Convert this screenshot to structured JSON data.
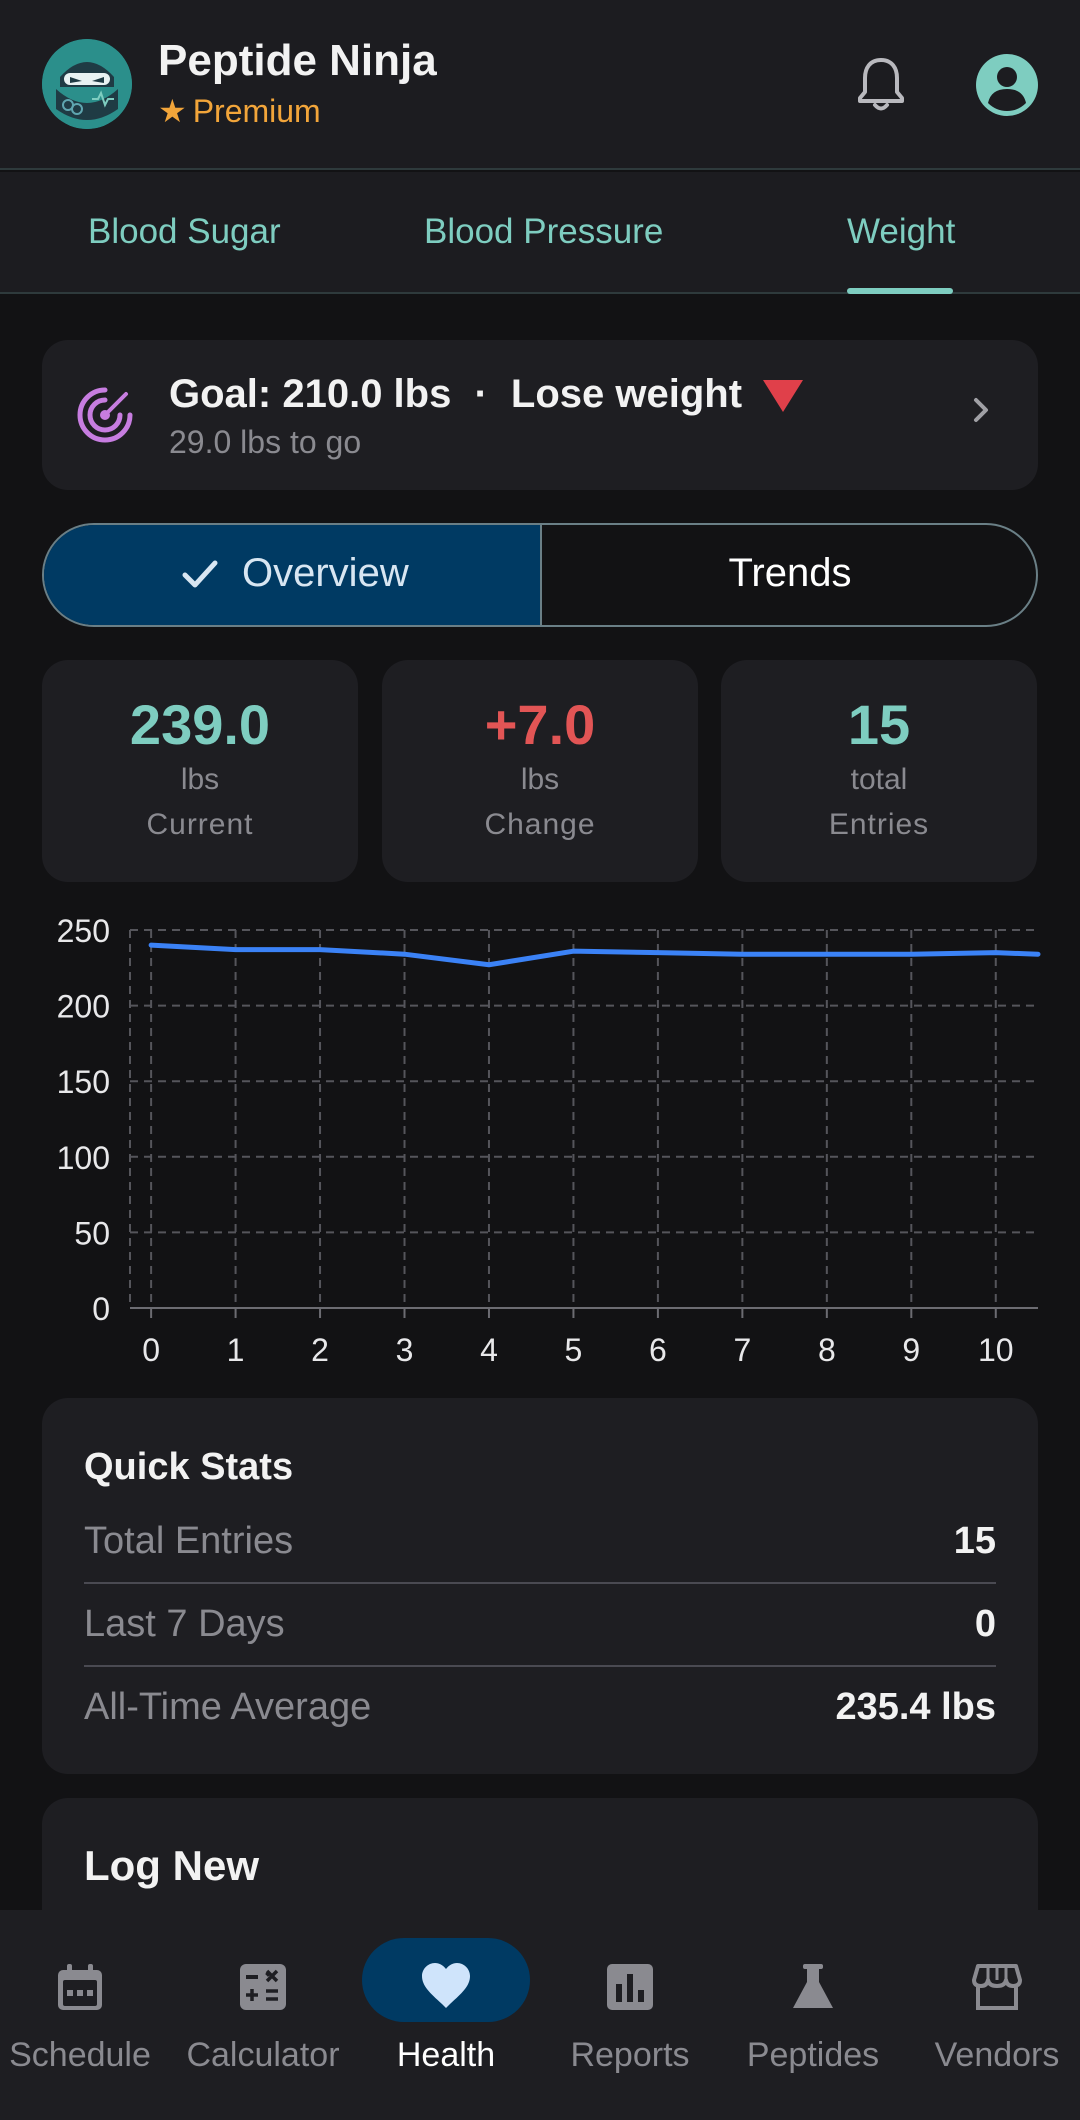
{
  "header": {
    "app_name": "Peptide Ninja",
    "tier": "Premium",
    "icons": [
      "ninja-logo",
      "bell-icon",
      "account-icon"
    ]
  },
  "tabs": [
    {
      "label": "Blood Sugar",
      "active": false
    },
    {
      "label": "Blood Pressure",
      "active": false
    },
    {
      "label": "Weight",
      "active": true
    }
  ],
  "goal": {
    "title": "Goal: 210.0 lbs",
    "separator": "·",
    "direction": "Lose weight",
    "subtitle": "29.0 lbs to go"
  },
  "segments": {
    "overview": "Overview",
    "trends": "Trends",
    "selected": "overview"
  },
  "stats": [
    {
      "value": "239.0",
      "unit": "lbs",
      "label": "Current",
      "color": "#7ecdc0"
    },
    {
      "value": "+7.0",
      "unit": "lbs",
      "label": "Change",
      "color": "#e25555"
    },
    {
      "value": "15",
      "unit": "total",
      "label": "Entries",
      "color": "#7ecdc0"
    }
  ],
  "chart_data": {
    "type": "line",
    "x": [
      0,
      1,
      2,
      3,
      4,
      5,
      6,
      7,
      8,
      9,
      10,
      10.5
    ],
    "series": [
      {
        "values": [
          240,
          237,
          237,
          234,
          227,
          236,
          235,
          234,
          234,
          234,
          235,
          234
        ]
      }
    ],
    "xticks": [
      "0",
      "1",
      "2",
      "3",
      "4",
      "5",
      "6",
      "7",
      "8",
      "9",
      "10"
    ],
    "yticks": [
      "0",
      "50",
      "100",
      "150",
      "200",
      "250"
    ],
    "xlim": [
      -0.25,
      10.5
    ],
    "ylim": [
      0,
      250
    ],
    "grid": true,
    "line_color": "#3b82f6"
  },
  "quick_stats": {
    "title": "Quick Stats",
    "rows": [
      {
        "label": "Total Entries",
        "value": "15"
      },
      {
        "label": "Last 7 Days",
        "value": "0"
      },
      {
        "label": "All-Time Average",
        "value": "235.4 lbs"
      }
    ]
  },
  "log_new": {
    "title": "Log New"
  },
  "bottom_nav": [
    {
      "label": "Schedule",
      "icon": "calendar-icon",
      "active": false
    },
    {
      "label": "Calculator",
      "icon": "calculator-icon",
      "active": false
    },
    {
      "label": "Health",
      "icon": "heart-icon",
      "active": true
    },
    {
      "label": "Reports",
      "icon": "bar-chart-icon",
      "active": false
    },
    {
      "label": "Peptides",
      "icon": "flask-icon",
      "active": false
    },
    {
      "label": "Vendors",
      "icon": "store-icon",
      "active": false
    }
  ]
}
